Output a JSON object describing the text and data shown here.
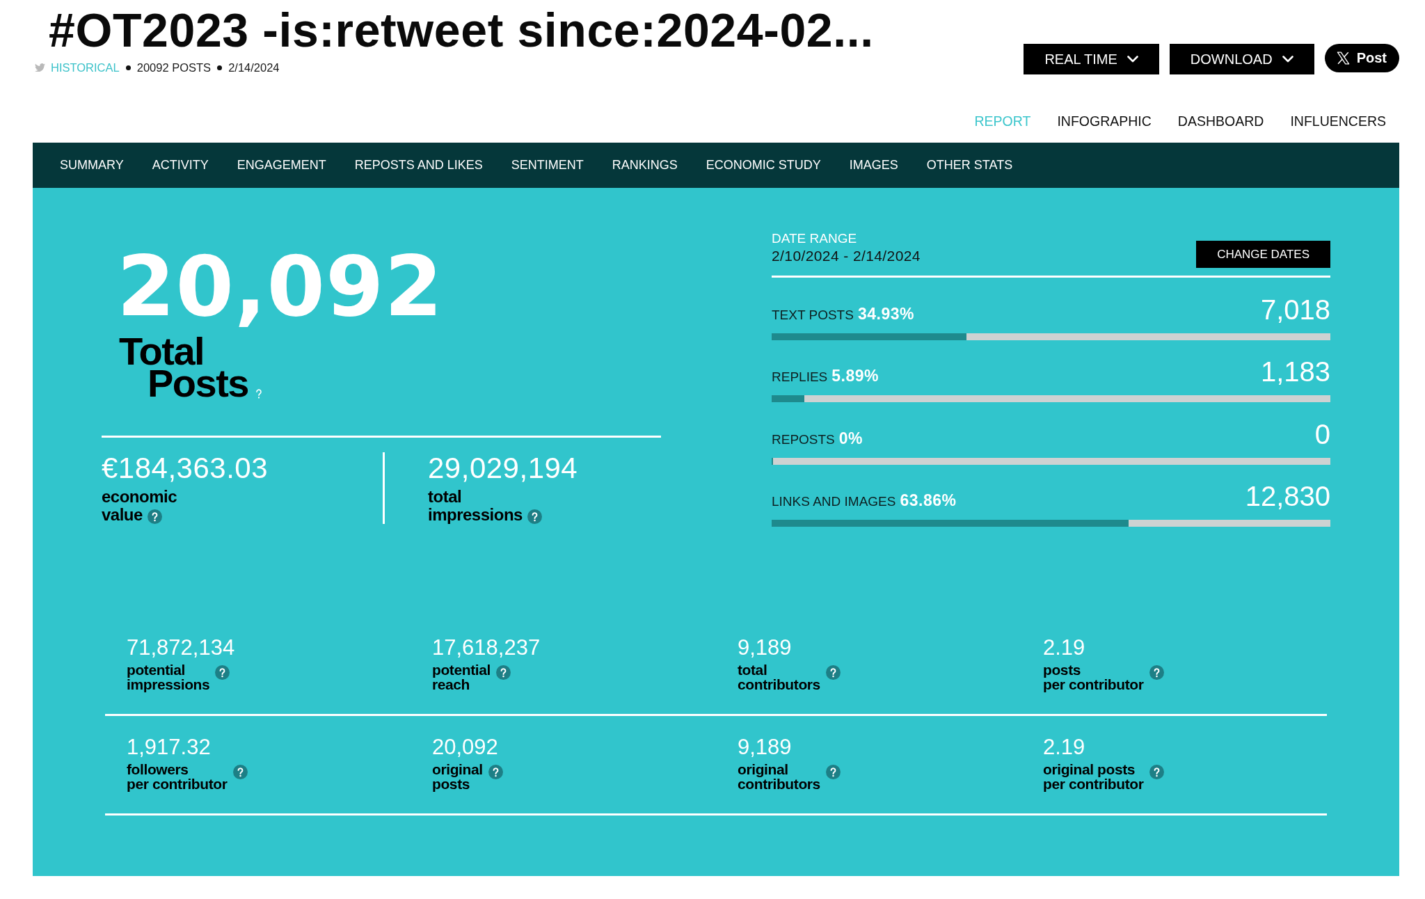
{
  "header": {
    "title": "#OT2023 -is:retweet since:2024-02...",
    "meta": [
      {
        "kind": "link",
        "text": "HISTORICAL"
      },
      {
        "kind": "text",
        "text": "20092 POSTS"
      },
      {
        "kind": "text",
        "text": "2/14/2024"
      }
    ]
  },
  "actions": [
    {
      "kind": "dropdown",
      "label": "REAL TIME"
    },
    {
      "kind": "dropdown",
      "label": "DOWNLOAD"
    },
    {
      "kind": "share",
      "label": "Post"
    }
  ],
  "view_tabs": [
    {
      "label": "REPORT",
      "selected": true
    },
    {
      "label": "INFOGRAPHIC",
      "selected": false
    },
    {
      "label": "DASHBOARD",
      "selected": false
    },
    {
      "label": "INFLUENCERS",
      "selected": false
    }
  ],
  "section_nav": [
    "SUMMARY",
    "ACTIVITY",
    "ENGAGEMENT",
    "REPOSTS AND LIKES",
    "SENTIMENT",
    "RANKINGS",
    "ECONOMIC STUDY",
    "IMAGES",
    "OTHER STATS"
  ],
  "summary": {
    "total_posts": {
      "value": "20,092",
      "label_lines": [
        "Total",
        "Posts"
      ]
    },
    "key_figures": [
      {
        "value": "€184,363.03",
        "label_lines": [
          "economic",
          "value"
        ]
      },
      {
        "value": "29,029,194",
        "label_lines": [
          "total",
          "impressions"
        ]
      }
    ],
    "date_range": {
      "label": "DATE RANGE",
      "value": "2/10/2024 - 2/14/2024",
      "button": "CHANGE DATES"
    },
    "breakdown": [
      {
        "label": "TEXT POSTS",
        "percent": "34.93%",
        "count": "7,018",
        "level": 0.3493
      },
      {
        "label": "REPLIES",
        "percent": "5.89%",
        "count": "1,183",
        "level": 0.0589
      },
      {
        "label": "REPOSTS",
        "percent": "0%",
        "count": "0",
        "level": 0
      },
      {
        "label": "LINKS AND IMAGES",
        "percent": "63.86%",
        "count": "12,830",
        "level": 0.6386
      }
    ],
    "stats_rows": [
      [
        {
          "value": "71,872,134",
          "label_lines": [
            "potential",
            "impressions"
          ]
        },
        {
          "value": "17,618,237",
          "label_lines": [
            "potential",
            "reach"
          ]
        },
        {
          "value": "9,189",
          "label_lines": [
            "total",
            "contributors"
          ]
        },
        {
          "value": "2.19",
          "label_lines": [
            "posts",
            "per contributor"
          ]
        }
      ],
      [
        {
          "value": "1,917.32",
          "label_lines": [
            "followers",
            "per contributor"
          ]
        },
        {
          "value": "20,092",
          "label_lines": [
            "original",
            "posts"
          ]
        },
        {
          "value": "9,189",
          "label_lines": [
            "original",
            "contributors"
          ]
        },
        {
          "value": "2.19",
          "label_lines": [
            "original posts",
            "per contributor"
          ]
        }
      ]
    ]
  }
}
